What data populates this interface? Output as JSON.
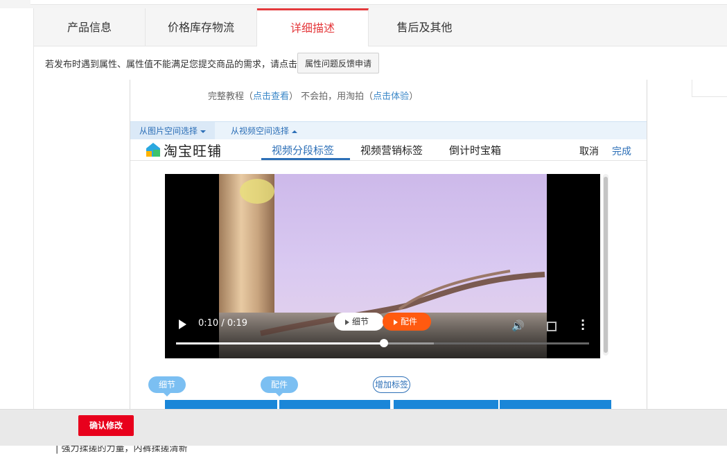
{
  "tabs": [
    {
      "label": "产品信息"
    },
    {
      "label": "价格库存物流"
    },
    {
      "label": "详细描述"
    },
    {
      "label": "售后及其他"
    }
  ],
  "notice": {
    "text": "若发布时遇到属性、属性值不能满足您提交商品的需求，请点击",
    "button": "属性问题反馈申请"
  },
  "editor": {
    "tutorial_prefix": "完整教程（",
    "tutorial_link": "点击查看",
    "tutorial_mid": "）   不会拍，用淘拍（",
    "tutorial_link2": "点击体验",
    "tutorial_suffix": "）",
    "source_tabs": [
      "从图片空间选择",
      "从视频空间选择"
    ],
    "brand": "淘宝旺铺",
    "widget_tabs": [
      "视频分段标签",
      "视频营销标签",
      "倒计时宝箱"
    ],
    "active_widget_tab": "视频分段标签",
    "cancel": "取消",
    "done": "完成"
  },
  "video": {
    "time": "0:10 / 0:19",
    "progress": 0.53,
    "chips": [
      "细节",
      "配件"
    ]
  },
  "tags": [
    "细节",
    "配件",
    "增加标签"
  ],
  "footer": {
    "confirm": "确认修改",
    "below_text": "| 强力揉搓的力量，内裤揉搓清新"
  },
  "colors": {
    "accent_red": "#e4393c",
    "link_blue": "#2c6fb7",
    "chip_orange": "#ff5a10",
    "segment_blue": "#1a86d8"
  }
}
